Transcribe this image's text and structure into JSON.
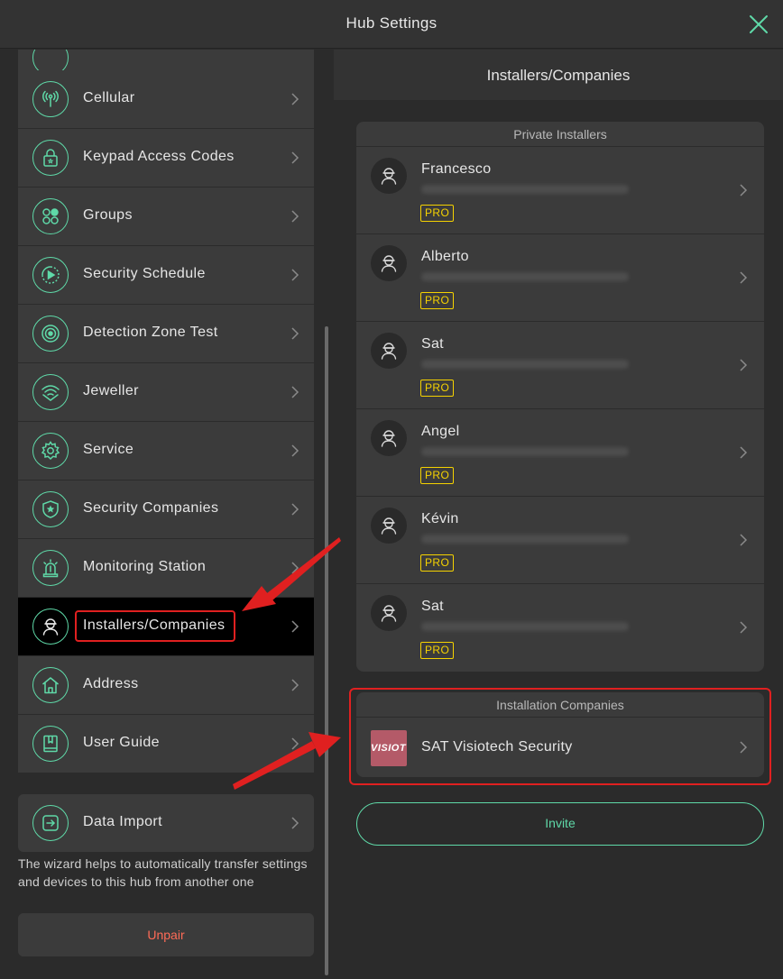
{
  "window": {
    "title": "Hub Settings"
  },
  "sidebar": {
    "items": [
      {
        "key": "top",
        "label": "",
        "icon": "generic-icon"
      },
      {
        "key": "cellular",
        "label": "Cellular",
        "icon": "cellular-antenna-icon"
      },
      {
        "key": "keypad",
        "label": "Keypad Access Codes",
        "icon": "lock-icon"
      },
      {
        "key": "groups",
        "label": "Groups",
        "icon": "groups-icon"
      },
      {
        "key": "schedule",
        "label": "Security Schedule",
        "icon": "schedule-icon"
      },
      {
        "key": "zone-test",
        "label": "Detection Zone Test",
        "icon": "target-icon"
      },
      {
        "key": "jeweller",
        "label": "Jeweller",
        "icon": "wifi-shield-icon"
      },
      {
        "key": "service",
        "label": "Service",
        "icon": "gear-icon"
      },
      {
        "key": "security-companies",
        "label": "Security Companies",
        "icon": "shield-star-icon"
      },
      {
        "key": "monitoring",
        "label": "Monitoring Station",
        "icon": "siren-icon"
      },
      {
        "key": "installers",
        "label": "Installers/Companies",
        "icon": "installer-icon",
        "selected": true
      },
      {
        "key": "address",
        "label": "Address",
        "icon": "house-icon"
      },
      {
        "key": "guide",
        "label": "User Guide",
        "icon": "book-icon"
      }
    ],
    "data_import": {
      "label": "Data Import",
      "icon": "import-icon"
    },
    "wizard_text": "The wizard helps to automatically transfer settings and devices to this hub from another one",
    "unpair_label": "Unpair"
  },
  "panel": {
    "title": "Installers/Companies",
    "private_section_title": "Private Installers",
    "installers": [
      {
        "name": "Francesco",
        "badge": "PRO"
      },
      {
        "name": "Alberto",
        "badge": "PRO"
      },
      {
        "name": "Sat",
        "badge": "PRO"
      },
      {
        "name": "Angel",
        "badge": "PRO"
      },
      {
        "name": "Kévin",
        "badge": "PRO"
      },
      {
        "name": "Sat",
        "badge": "PRO"
      }
    ],
    "companies_section_title": "Installation Companies",
    "company": {
      "name": "SAT Visiotech Security",
      "logo_text": "VISIOT"
    },
    "invite_label": "Invite"
  },
  "colors": {
    "accent": "#5fd9a8",
    "danger": "#ff6b57",
    "badge": "#f5d200",
    "annotation": "#e02020",
    "selected_bg": "#000000"
  }
}
